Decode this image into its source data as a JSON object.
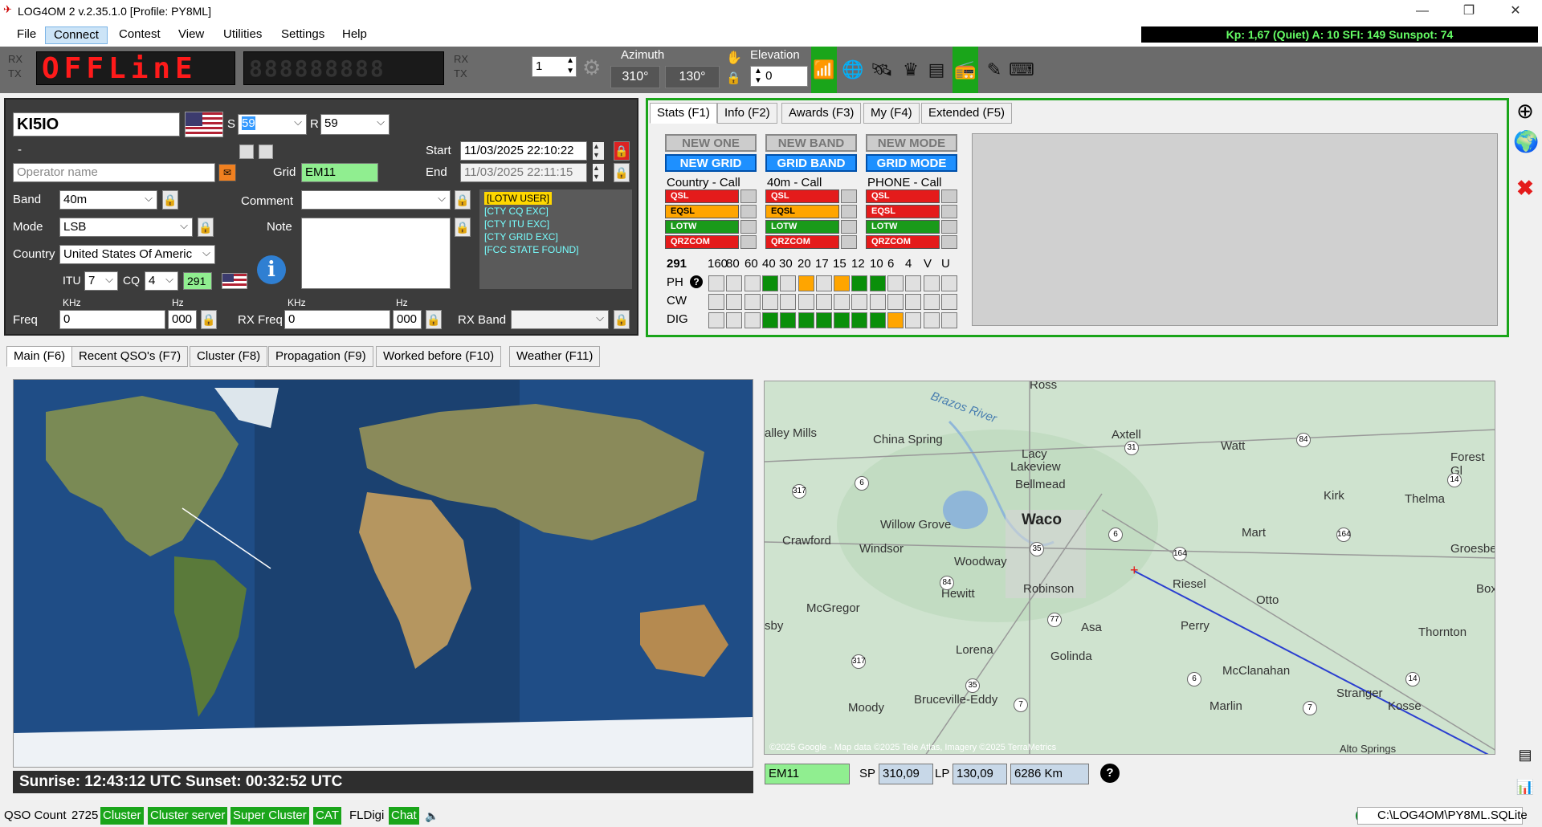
{
  "window": {
    "title": "LOG4OM 2 v.2.35.1.0 [Profile: PY8ML]",
    "min": "—",
    "restore": "❐",
    "close": "✕"
  },
  "menu": [
    "File",
    "Connect",
    "Contest",
    "View",
    "Utilities",
    "Settings",
    "Help"
  ],
  "kp_status": "Kp: 1,67 (Quiet)  A: 10  SFI: 149 Sunspot: 74",
  "toolbar": {
    "rx": "RX",
    "tx": "TX",
    "display": "OFFLinE",
    "display_dim": "888888888",
    "counter": "1",
    "azimuth_label": "Azimuth",
    "azimuth_sp": "310°",
    "azimuth_lp": "130°",
    "elevation_label": "Elevation",
    "elevation_value": "0"
  },
  "qso": {
    "callsign": "KI5IO",
    "s_label": "S",
    "rst_sent": "59",
    "r_label": "R",
    "rst_rcvd": "59",
    "dash": "-",
    "operator_placeholder": "Operator name",
    "grid_label": "Grid",
    "grid": "EM11",
    "start_label": "Start",
    "start": "11/03/2025 22:10:22",
    "end_label": "End",
    "end": "11/03/2025 22:11:15",
    "band_label": "Band",
    "band": "40m",
    "comment_label": "Comment",
    "comment": "",
    "mode_label": "Mode",
    "mode": "LSB",
    "note_label": "Note",
    "country_label": "Country",
    "country": "United States Of Americ",
    "itu_label": "ITU",
    "itu": "7",
    "cq_label": "CQ",
    "cq": "4",
    "dxcc": "291",
    "khz_label": "KHz",
    "hz_label": "Hz",
    "freq_label": "Freq",
    "freq_khz": "0",
    "freq_hz": "000",
    "rxfreq_label": "RX Freq",
    "rxfreq_khz": "0",
    "rxfreq_hz": "000",
    "rxband_label": "RX Band",
    "rxband": "",
    "tags": [
      "[LOTW USER]",
      "[CTY CQ EXC]",
      "[CTY ITU EXC]",
      "[CTY GRID EXC]",
      "[FCC STATE FOUND]"
    ]
  },
  "stats_tabs": [
    "Stats (F1)",
    "Info (F2)",
    "Awards (F3)",
    "My (F4)",
    "Extended (F5)"
  ],
  "stats": {
    "new_one": "NEW ONE",
    "new_band": "NEW BAND",
    "new_mode": "NEW MODE",
    "new_grid": "NEW GRID",
    "grid_band": "GRID BAND",
    "grid_mode": "GRID MODE",
    "col_titles": [
      "Country - Call",
      "40m - Call",
      "PHONE - Call"
    ],
    "services": [
      "QSL",
      "EQSL",
      "LOTW",
      "QRZCOM"
    ],
    "dxcc": "291",
    "bands": [
      "160",
      "80",
      "60",
      "40",
      "30",
      "20",
      "17",
      "15",
      "12",
      "10",
      "6",
      "4",
      "V",
      "U"
    ],
    "modes": [
      "PH",
      "CW",
      "DIG"
    ]
  },
  "main_tabs": [
    "Main (F6)",
    "Recent QSO's (F7)",
    "Cluster (F8)",
    "Propagation (F9)",
    "Worked before (F10)",
    "Weather (F11)"
  ],
  "sun": "Sunrise: 12:43:12 UTC   Sunset: 00:32:52 UTC",
  "map_labels": {
    "brazos": "Brazos River",
    "ross": "Ross",
    "valley_mills": "alley Mills",
    "china_spring": "China Spring",
    "axtell": "Axtell",
    "watt": "Watt",
    "lacy": "Lacy",
    "lakeview": "Lakeview",
    "bellmead": "Bellmead",
    "forest": "Forest Gl",
    "kirk": "Kirk",
    "thelma": "Thelma",
    "willow_grove": "Willow Grove",
    "waco": "Waco",
    "crawford": "Crawford",
    "windsor": "Windsor",
    "mart": "Mart",
    "groesbeck": "Groesbec",
    "woodway": "Woodway",
    "riesel": "Riesel",
    "hewitt": "Hewitt",
    "robinson": "Robinson",
    "otto": "Otto",
    "box": "Box",
    "mcgregor": "McGregor",
    "sby": "sby",
    "asa": "Asa",
    "perry": "Perry",
    "thornton": "Thornton",
    "lorena": "Lorena",
    "golinda": "Golinda",
    "mcclanahan": "McClanahan",
    "bruceville": "Bruceville-Eddy",
    "moody": "Moody",
    "stranger": "Stranger",
    "marlin": "Marlin",
    "kosse": "Kosse",
    "alto": "Alto Springs",
    "copyright": "©2025 Google - Map data ©2025 Tele Atlas, Imagery ©2025 TerraMetrics"
  },
  "map_badges": [
    "31",
    "84",
    "6",
    "317",
    "14",
    "6",
    "164",
    "164",
    "35",
    "84",
    "77",
    "317",
    "6",
    "14",
    "7",
    "35",
    "7"
  ],
  "bearing": {
    "grid": "EM11",
    "sp_label": "SP",
    "sp": "310,09",
    "lp_label": "LP",
    "lp": "130,09",
    "distance": "6286 Km"
  },
  "statusbar": {
    "qso_count_label": "QSO Count",
    "qso_count": "2725",
    "items": [
      "Cluster",
      "Cluster server",
      "Super Cluster",
      "CAT",
      "FLDigi",
      "Chat"
    ],
    "db_path": "C:\\LOG4OM\\PY8ML.SQLite"
  },
  "colors": {
    "green_accent": "#1aa51a",
    "blue": "#1e90ff",
    "red": "#e41b1b",
    "orange": "#ffa500"
  }
}
